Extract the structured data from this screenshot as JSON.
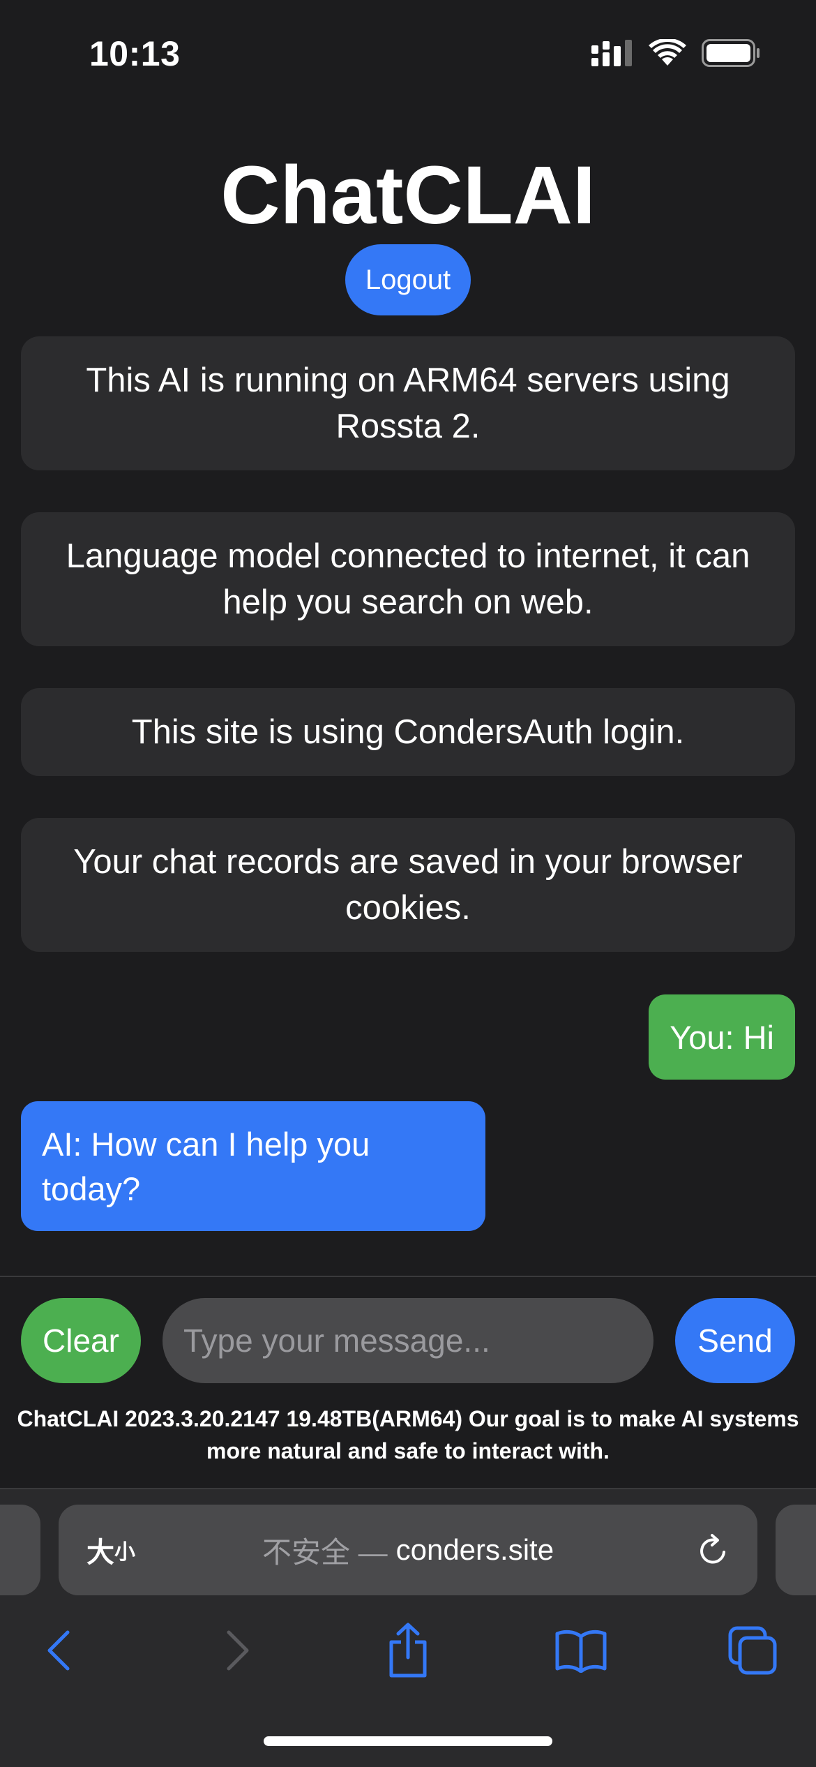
{
  "status_bar": {
    "time": "10:13",
    "icons": [
      "cellular-signal-icon",
      "wifi-icon",
      "battery-icon"
    ]
  },
  "header": {
    "title": "ChatCLAI",
    "logout_label": "Logout"
  },
  "info_cards": [
    "This AI is running on ARM64 servers using Rossta 2.",
    "Language model connected to internet, it can help you search on web.",
    "This site is using CondersAuth login.",
    "Your chat records are saved in your browser cookies."
  ],
  "messages": {
    "user": "You: Hi",
    "ai": "AI: How can I help you today?"
  },
  "input_row": {
    "clear_label": "Clear",
    "placeholder": "Type your message...",
    "value": "",
    "send_label": "Send"
  },
  "footer": "ChatCLAI 2023.3.20.2147 19.48TB(ARM64) Our goal is to make AI systems more natural and safe to interact with.",
  "browser": {
    "reader_big": "大",
    "reader_small": "小",
    "insecure_label": "不安全 —",
    "domain": "conders.site",
    "toolbar_icons": [
      "back-icon",
      "forward-icon",
      "share-icon",
      "bookmarks-icon",
      "tabs-icon"
    ]
  },
  "colors": {
    "background": "#1c1c1e",
    "card": "#2c2c2e",
    "accent_blue": "#3478f6",
    "accent_green": "#4caf50"
  }
}
